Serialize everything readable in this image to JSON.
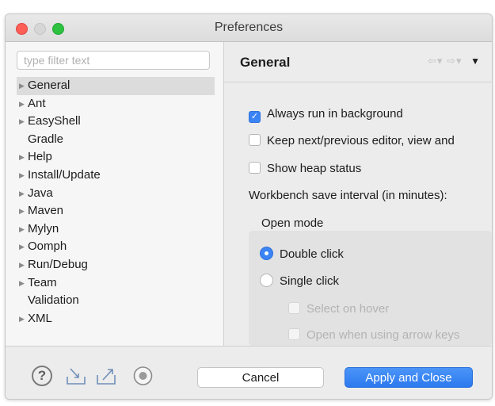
{
  "window": {
    "title": "Preferences"
  },
  "filter": {
    "placeholder": "type filter text",
    "value": ""
  },
  "tree": [
    {
      "label": "General",
      "expandable": true,
      "selected": true
    },
    {
      "label": "Ant",
      "expandable": true
    },
    {
      "label": "EasyShell",
      "expandable": true
    },
    {
      "label": "Gradle",
      "expandable": false
    },
    {
      "label": "Help",
      "expandable": true
    },
    {
      "label": "Install/Update",
      "expandable": true
    },
    {
      "label": "Java",
      "expandable": true
    },
    {
      "label": "Maven",
      "expandable": true
    },
    {
      "label": "Mylyn",
      "expandable": true
    },
    {
      "label": "Oomph",
      "expandable": true
    },
    {
      "label": "Run/Debug",
      "expandable": true
    },
    {
      "label": "Team",
      "expandable": true
    },
    {
      "label": "Validation",
      "expandable": false
    },
    {
      "label": "XML",
      "expandable": true
    }
  ],
  "page": {
    "title": "General",
    "options": {
      "always_run": {
        "label": "Always run in background",
        "checked": true
      },
      "keep_next": {
        "label": "Keep next/previous editor, view and",
        "checked": false
      },
      "heap_status": {
        "label": "Show heap status",
        "checked": false
      }
    },
    "save_interval_label": "Workbench save interval (in minutes):",
    "open_mode": {
      "label": "Open mode",
      "double_click": "Double click",
      "single_click": "Single click",
      "selected": "double_click",
      "select_on_hover": "Select on hover",
      "open_arrow_keys": "Open when using arrow keys"
    }
  },
  "buttons": {
    "cancel": "Cancel",
    "apply_close": "Apply and Close"
  },
  "icons": [
    "help-icon",
    "import-icon",
    "export-icon",
    "record-icon",
    "back-icon",
    "forward-icon",
    "view-menu-icon"
  ],
  "colors": {
    "accent": "#3b84f5"
  }
}
